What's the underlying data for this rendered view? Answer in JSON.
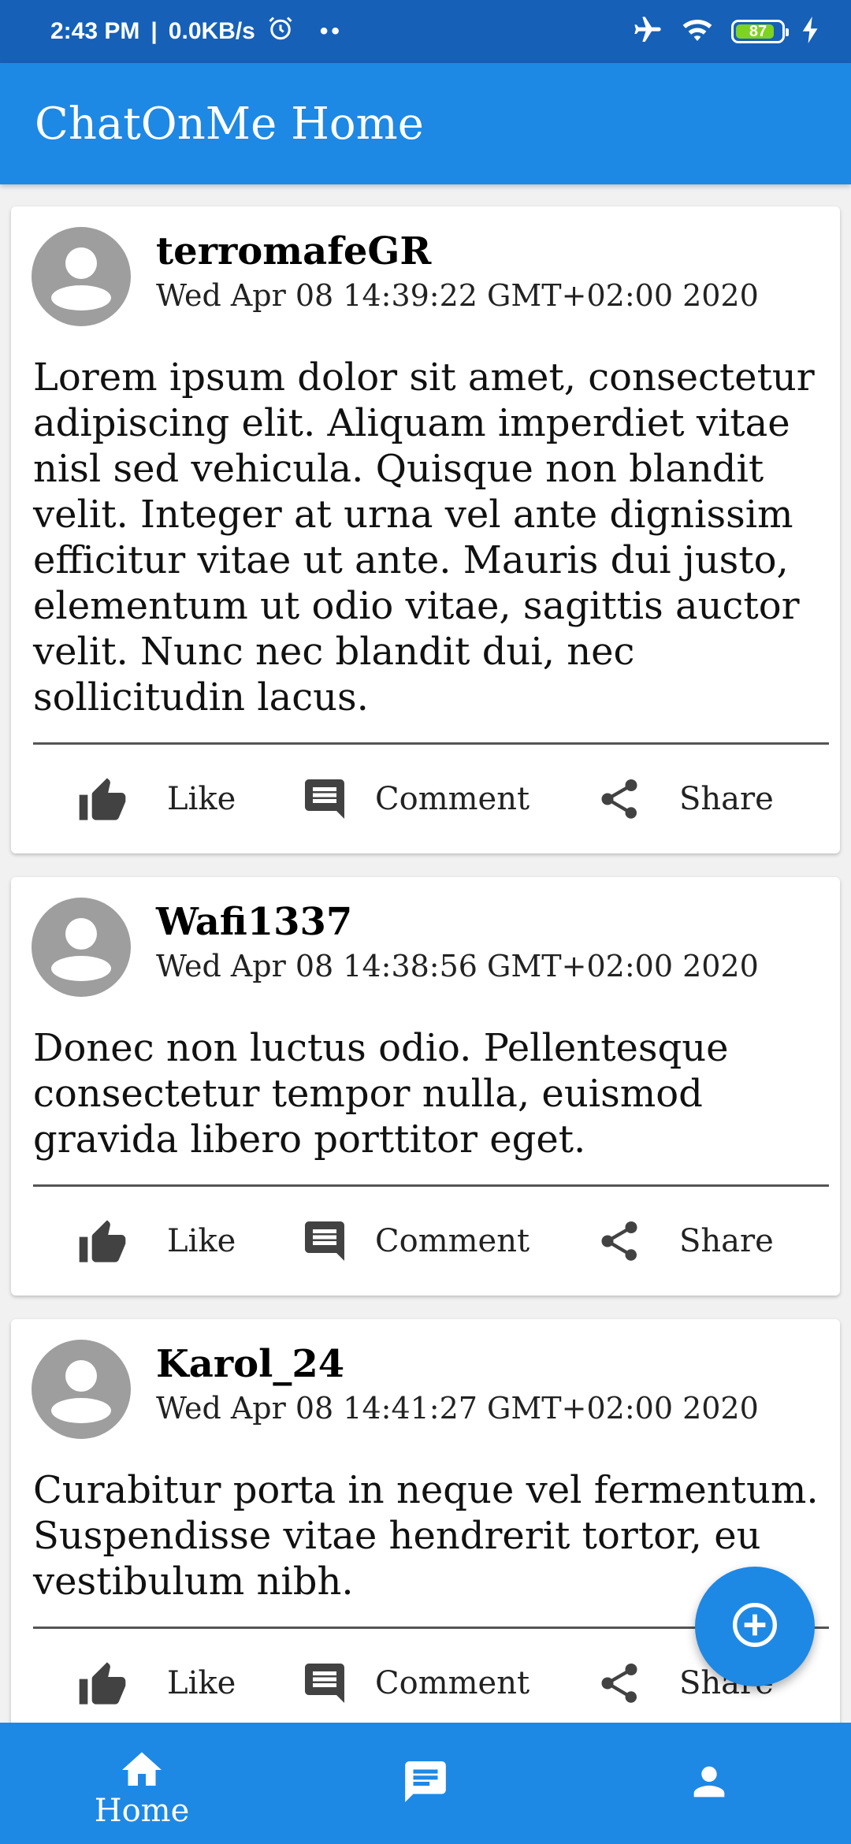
{
  "status_bar": {
    "time": "2:43 PM",
    "separator": "|",
    "speed": "0.0KB/s",
    "dots": "••",
    "battery_percent": "87",
    "battery_level": 0.87
  },
  "app_bar": {
    "title": "ChatOnMe Home"
  },
  "posts": [
    {
      "author": "terromafeGR",
      "timestamp": "Wed Apr 08 14:39:22 GMT+02:00 2020",
      "body": "Lorem ipsum dolor sit amet, consectetur adipiscing elit. Aliquam imperdiet vitae nisl sed vehicula. Quisque non blandit velit. Integer at urna vel ante dignissim efficitur vitae ut ante. Mauris dui justo, elementum ut odio vitae, sagittis auctor velit. Nunc nec blandit dui, nec sollicitudin lacus.",
      "actions": {
        "like": "Like",
        "comment": "Comment",
        "share": "Share"
      }
    },
    {
      "author": "Wafi1337",
      "timestamp": "Wed Apr 08 14:38:56 GMT+02:00 2020",
      "body": "Donec non luctus odio. Pellentesque consectetur tempor nulla, euismod gravida libero porttitor eget.",
      "actions": {
        "like": "Like",
        "comment": "Comment",
        "share": "Share"
      }
    },
    {
      "author": "Karol_24",
      "timestamp": "Wed Apr 08 14:41:27 GMT+02:00 2020",
      "body": "Curabitur porta in neque vel fermentum. Suspendisse vitae hendrerit tortor, eu vestibulum nibh.",
      "actions": {
        "like": "Like",
        "comment": "Comment",
        "share": "Share"
      }
    }
  ],
  "bottom_nav": {
    "items": [
      {
        "label": "Home",
        "icon": "home-icon"
      },
      {
        "label": "",
        "icon": "chat-icon"
      },
      {
        "label": "",
        "icon": "profile-icon"
      }
    ]
  },
  "colors": {
    "primary": "#1e88e5",
    "status_bar": "#1660b8",
    "avatar": "#9e9e9e",
    "battery": "#7ed321"
  }
}
